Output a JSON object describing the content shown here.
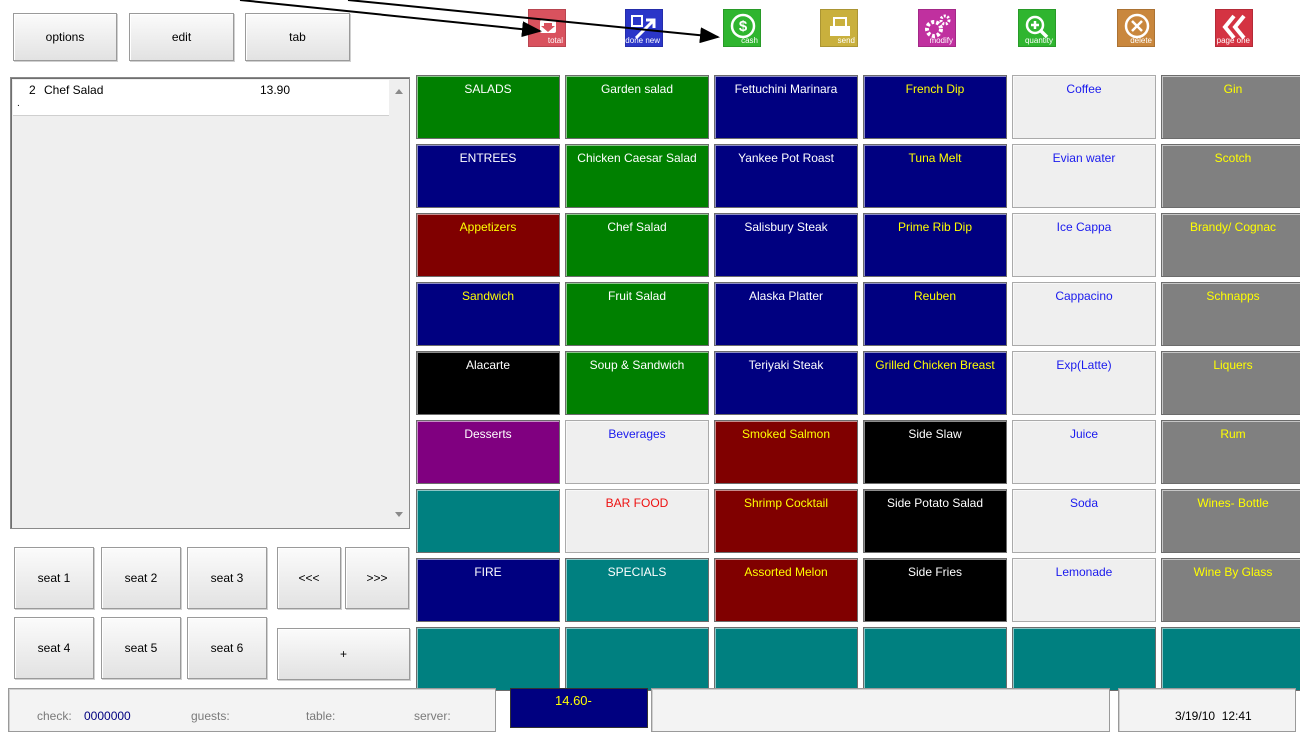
{
  "top_buttons": {
    "options": "options",
    "edit": "edit",
    "tab": "tab"
  },
  "toolbar": [
    {
      "id": "total",
      "label": "total",
      "color": "#d9525e"
    },
    {
      "id": "done-new",
      "label": "done new",
      "color": "#2b36c8"
    },
    {
      "id": "cash",
      "label": "cash",
      "color": "#2fb52f"
    },
    {
      "id": "send",
      "label": "send",
      "color": "#c9b03d"
    },
    {
      "id": "modify",
      "label": "modify",
      "color": "#c0309f"
    },
    {
      "id": "quantity",
      "label": "quantity",
      "color": "#2fb52f"
    },
    {
      "id": "delete",
      "label": "delete",
      "color": "#c9873d"
    },
    {
      "id": "page-one",
      "label": "page one",
      "color": "#d43342"
    }
  ],
  "order": {
    "items": [
      {
        "qty": "2",
        "name": "Chef Salad",
        "price": "13.90"
      }
    ],
    "sub_line": "."
  },
  "seats": {
    "seat1": "seat 1",
    "seat2": "seat 2",
    "seat3": "seat 3",
    "seat4": "seat 4",
    "seat5": "seat 5",
    "seat6": "seat 6",
    "prev": "<<<",
    "next": ">>>",
    "plus": "+"
  },
  "menu_grid": [
    [
      {
        "label": "SALADS",
        "bg": "green",
        "fg": "white"
      },
      {
        "label": "Garden salad",
        "bg": "green",
        "fg": "white"
      },
      {
        "label": "Fettuchini Marinara",
        "bg": "navy",
        "fg": "white"
      },
      {
        "label": "French Dip",
        "bg": "navy",
        "fg": "yellow"
      },
      {
        "label": "Coffee",
        "bg": "light",
        "fg": "blue"
      },
      {
        "label": "Gin",
        "bg": "gray",
        "fg": "yellow"
      }
    ],
    [
      {
        "label": "ENTREES",
        "bg": "navy",
        "fg": "white"
      },
      {
        "label": "Chicken Caesar Salad",
        "bg": "green",
        "fg": "white"
      },
      {
        "label": "Yankee Pot Roast",
        "bg": "navy",
        "fg": "white"
      },
      {
        "label": "Tuna Melt",
        "bg": "navy",
        "fg": "yellow"
      },
      {
        "label": "Evian water",
        "bg": "light",
        "fg": "blue"
      },
      {
        "label": "Scotch",
        "bg": "gray",
        "fg": "yellow"
      }
    ],
    [
      {
        "label": "Appetizers",
        "bg": "maroon",
        "fg": "yellow"
      },
      {
        "label": "Chef Salad",
        "bg": "green",
        "fg": "white"
      },
      {
        "label": "Salisbury Steak",
        "bg": "navy",
        "fg": "white"
      },
      {
        "label": "Prime Rib Dip",
        "bg": "navy",
        "fg": "yellow"
      },
      {
        "label": "Ice Cappa",
        "bg": "light",
        "fg": "blue"
      },
      {
        "label": "Brandy/ Cognac",
        "bg": "gray",
        "fg": "yellow"
      }
    ],
    [
      {
        "label": "Sandwich",
        "bg": "navy",
        "fg": "yellow"
      },
      {
        "label": "Fruit Salad",
        "bg": "green",
        "fg": "white"
      },
      {
        "label": "Alaska Platter",
        "bg": "navy",
        "fg": "white"
      },
      {
        "label": "Reuben",
        "bg": "navy",
        "fg": "yellow"
      },
      {
        "label": "Cappacino",
        "bg": "light",
        "fg": "blue"
      },
      {
        "label": "Schnapps",
        "bg": "gray",
        "fg": "yellow"
      }
    ],
    [
      {
        "label": "Alacarte",
        "bg": "black",
        "fg": "white"
      },
      {
        "label": "Soup & Sandwich",
        "bg": "green",
        "fg": "white"
      },
      {
        "label": "Teriyaki Steak",
        "bg": "navy",
        "fg": "white"
      },
      {
        "label": "Grilled Chicken Breast",
        "bg": "navy",
        "fg": "yellow"
      },
      {
        "label": "Exp(Latte)",
        "bg": "light",
        "fg": "blue"
      },
      {
        "label": "Liquers",
        "bg": "gray",
        "fg": "yellow"
      }
    ],
    [
      {
        "label": "Desserts",
        "bg": "purple",
        "fg": "white"
      },
      {
        "label": "Beverages",
        "bg": "light",
        "fg": "blue"
      },
      {
        "label": "Smoked Salmon",
        "bg": "maroon",
        "fg": "yellow"
      },
      {
        "label": "Side Slaw",
        "bg": "black",
        "fg": "white"
      },
      {
        "label": "Juice",
        "bg": "light",
        "fg": "blue"
      },
      {
        "label": "Rum",
        "bg": "gray",
        "fg": "yellow"
      }
    ],
    [
      {
        "label": "",
        "bg": "teal",
        "fg": "white"
      },
      {
        "label": "BAR FOOD",
        "bg": "light",
        "fg": "red"
      },
      {
        "label": "Shrimp Cocktail",
        "bg": "maroon",
        "fg": "yellow"
      },
      {
        "label": "Side Potato Salad",
        "bg": "black",
        "fg": "white"
      },
      {
        "label": "Soda",
        "bg": "light",
        "fg": "blue"
      },
      {
        "label": "Wines- Bottle",
        "bg": "gray",
        "fg": "yellow"
      }
    ],
    [
      {
        "label": "FIRE",
        "bg": "navy",
        "fg": "white"
      },
      {
        "label": "SPECIALS",
        "bg": "teal",
        "fg": "white"
      },
      {
        "label": "Assorted Melon",
        "bg": "maroon",
        "fg": "yellow"
      },
      {
        "label": "Side Fries",
        "bg": "black",
        "fg": "white"
      },
      {
        "label": "Lemonade",
        "bg": "light",
        "fg": "blue"
      },
      {
        "label": "Wine By Glass",
        "bg": "gray",
        "fg": "yellow"
      }
    ],
    [
      {
        "label": "",
        "bg": "teal",
        "fg": "white"
      },
      {
        "label": "",
        "bg": "teal",
        "fg": "white"
      },
      {
        "label": "",
        "bg": "teal",
        "fg": "white"
      },
      {
        "label": "",
        "bg": "teal",
        "fg": "white"
      },
      {
        "label": "",
        "bg": "teal",
        "fg": "white"
      },
      {
        "label": "",
        "bg": "teal",
        "fg": "white"
      }
    ]
  ],
  "status": {
    "check_label": "check:",
    "check_value": "0000000",
    "guests_label": "guests:",
    "table_label": "table:",
    "server_label": "server:",
    "total": "14.60-",
    "datetime": "3/19/10  12:41"
  },
  "colors": {
    "total_box_bg": "#000080",
    "total_box_fg": "#ffff00",
    "check_value_fg": "#000080",
    "annotation_arrow": "#000000"
  }
}
